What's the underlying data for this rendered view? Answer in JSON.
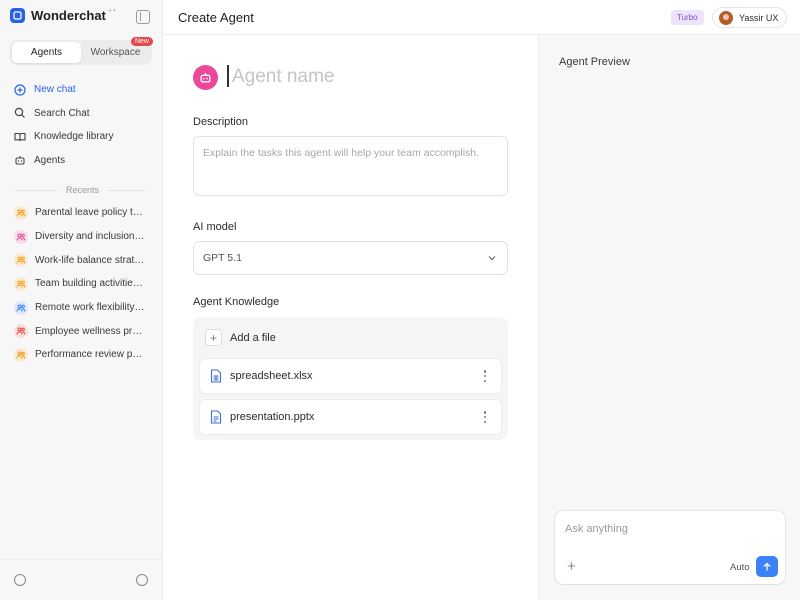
{
  "brand": {
    "name": "Wonderchat",
    "spark": "⁺⁺"
  },
  "tabs": [
    {
      "label": "Agents",
      "active": true
    },
    {
      "label": "Workspace",
      "badge": "New"
    }
  ],
  "nav": [
    {
      "label": "New chat",
      "icon": "plus-circle-icon"
    },
    {
      "label": "Search Chat",
      "icon": "search-icon"
    },
    {
      "label": "Knowledge library",
      "icon": "book-icon"
    },
    {
      "label": "Agents",
      "icon": "robot-icon"
    }
  ],
  "recents": {
    "label": "Recents",
    "items": [
      {
        "label": "Parental leave policy test",
        "color": "#f59e0b"
      },
      {
        "label": "Diversity and inclusion initiatives",
        "color": "#ec4899"
      },
      {
        "label": "Work-life balance strategies",
        "color": "#f59e0b"
      },
      {
        "label": "Team building activities ideas",
        "color": "#f59e0b"
      },
      {
        "label": "Remote work flexibility guidelines",
        "color": "#3b82f6"
      },
      {
        "label": "Employee wellness programs",
        "color": "#ef4444"
      },
      {
        "label": "Performance review process",
        "color": "#f59e0b"
      }
    ]
  },
  "header": {
    "title": "Create Agent",
    "badge": "Turbo",
    "user": "Yassir UX"
  },
  "form": {
    "name_placeholder": "Agent name",
    "description_label": "Description",
    "description_placeholder": "Explain the tasks this agent will help your team accomplish.",
    "model_label": "AI model",
    "model_value": "GPT 5.1",
    "knowledge_label": "Agent Knowledge",
    "add_file": "Add a file",
    "files": [
      {
        "name": "spreadsheet.xlsx",
        "icon": "spreadsheet-file-icon"
      },
      {
        "name": "presentation.pptx",
        "icon": "document-file-icon"
      }
    ]
  },
  "preview": {
    "title": "Agent Preview",
    "input_placeholder": "Ask anything",
    "mode": "Auto"
  },
  "colors": {
    "accent": "#2563eb",
    "agent_avatar": "#ec4899",
    "turbo_bg": "#ede4fb",
    "send": "#3b82f6"
  }
}
